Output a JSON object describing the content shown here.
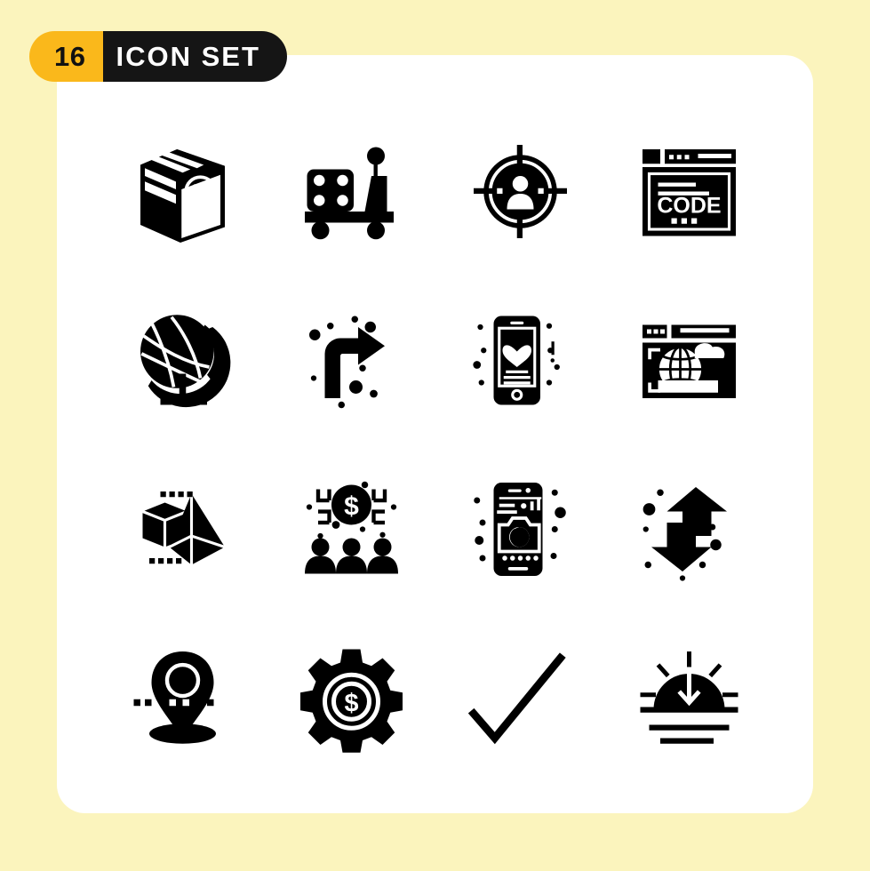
{
  "page": {
    "background_color": "#fbf4bd",
    "card_color": "#ffffff"
  },
  "badge": {
    "count": "16",
    "label": "ICON SET",
    "count_bg": "#fab81b",
    "count_fg": "#111111",
    "label_bg": "#151515",
    "label_fg": "#ffffff"
  },
  "icons": {
    "color": "#000000",
    "count": 16,
    "grid": {
      "columns": 4,
      "rows": 4
    },
    "items": [
      {
        "index": 1,
        "name": "damaged-package-icon",
        "label": "Damaged Package"
      },
      {
        "index": 2,
        "name": "luggage-trolley-icon",
        "label": "Luggage Trolley"
      },
      {
        "index": 3,
        "name": "target-audience-icon",
        "label": "Target Audience"
      },
      {
        "index": 4,
        "name": "code-window-icon",
        "label": "Code Window",
        "screen_text": "CODE"
      },
      {
        "index": 5,
        "name": "desk-globe-icon",
        "label": "Desk Globe"
      },
      {
        "index": 6,
        "name": "turn-right-arrow-icon",
        "label": "Turn Right Arrow"
      },
      {
        "index": 7,
        "name": "mobile-favorite-icon",
        "label": "Mobile Favorite"
      },
      {
        "index": 8,
        "name": "web-hosting-globe-icon",
        "label": "Web Hosting Globe"
      },
      {
        "index": 9,
        "name": "3d-shapes-icon",
        "label": "3D Shapes"
      },
      {
        "index": 10,
        "name": "crowdfunding-icon",
        "label": "Crowdfunding"
      },
      {
        "index": 11,
        "name": "mobile-camera-icon",
        "label": "Mobile Camera"
      },
      {
        "index": 12,
        "name": "data-transfer-arrows-icon",
        "label": "Data Transfer Arrows"
      },
      {
        "index": 13,
        "name": "map-location-pin-icon",
        "label": "Map Location Pin"
      },
      {
        "index": 14,
        "name": "money-settings-gear-icon",
        "label": "Money Settings Gear"
      },
      {
        "index": 15,
        "name": "checkmark-icon",
        "label": "Checkmark"
      },
      {
        "index": 16,
        "name": "sunset-download-icon",
        "label": "Sunset Download"
      }
    ]
  }
}
